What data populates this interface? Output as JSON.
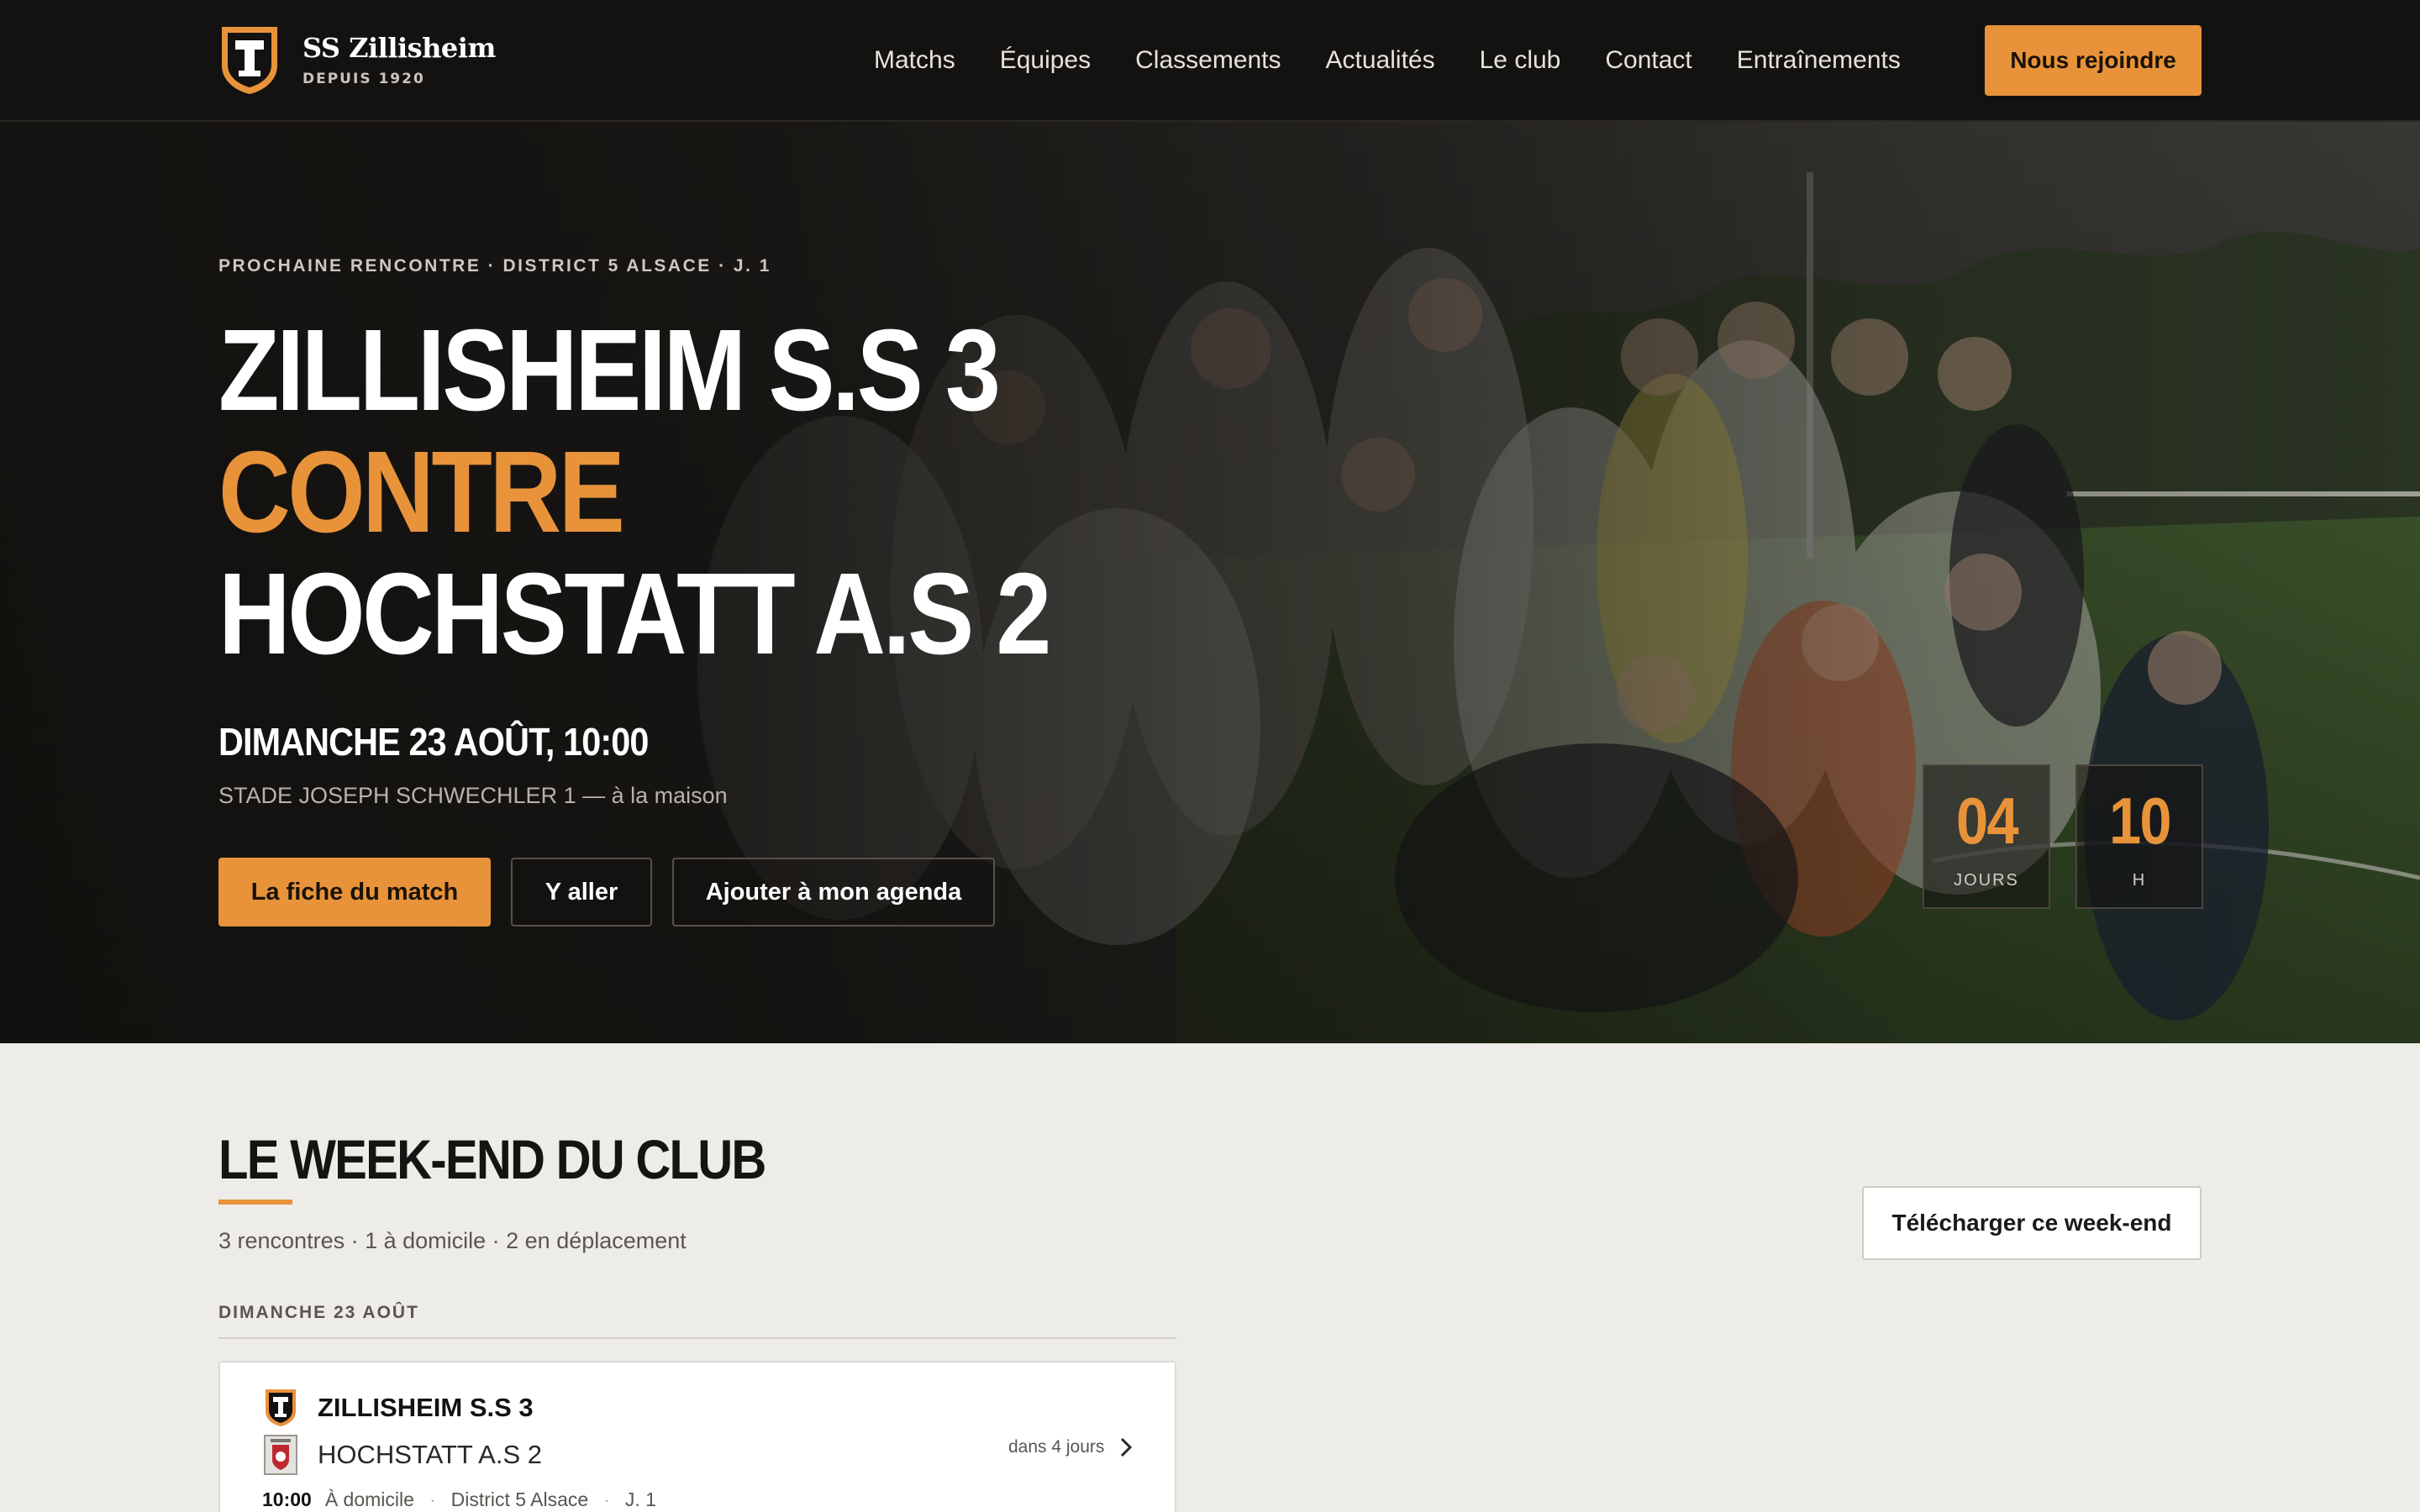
{
  "nav": {
    "club_name": "SS Zillisheim",
    "club_since": "DEPUIS 1920",
    "items": [
      "Matchs",
      "Équipes",
      "Classements",
      "Actualités",
      "Le club",
      "Contact",
      "Entraînements"
    ],
    "cta": "Nous rejoindre"
  },
  "hero": {
    "eyebrow": "PROCHAINE RENCONTRE · DISTRICT 5 ALSACE · J. 1",
    "home_team": "ZILLISHEIM S.S 3",
    "versus": "CONTRE",
    "away_team": "HOCHSTATT A.S 2",
    "date": "DIMANCHE 23 AOÛT, 10:00",
    "venue": "STADE JOSEPH SCHWECHLER 1 — à la maison",
    "buttons": {
      "details": "La fiche du match",
      "directions": "Y aller",
      "calendar": "Ajouter à mon agenda"
    },
    "countdown": {
      "days": "04",
      "days_label": "JOURS",
      "hours": "10",
      "hours_label": "H"
    }
  },
  "weekend": {
    "title": "LE WEEK-END DU CLUB",
    "summary": "3 rencontres · 1 à domicile · 2 en déplacement",
    "download": "Télécharger ce week-end",
    "day_label": "DIMANCHE 23 AOÛT",
    "matches": [
      {
        "home": "ZILLISHEIM S.S 3",
        "away": "HOCHSTATT A.S 2",
        "relative": "dans 4 jours",
        "time": "10:00",
        "location": "À domicile",
        "competition": "District 5 Alsace",
        "round": "J. 1"
      }
    ]
  },
  "colors": {
    "accent": "#e8933a",
    "dark": "#141210",
    "background": "#eeece8"
  },
  "icons": {
    "club_logo": "shield-t-icon",
    "chevron": "chevron-right-icon",
    "away_crest": "crest-icon"
  }
}
